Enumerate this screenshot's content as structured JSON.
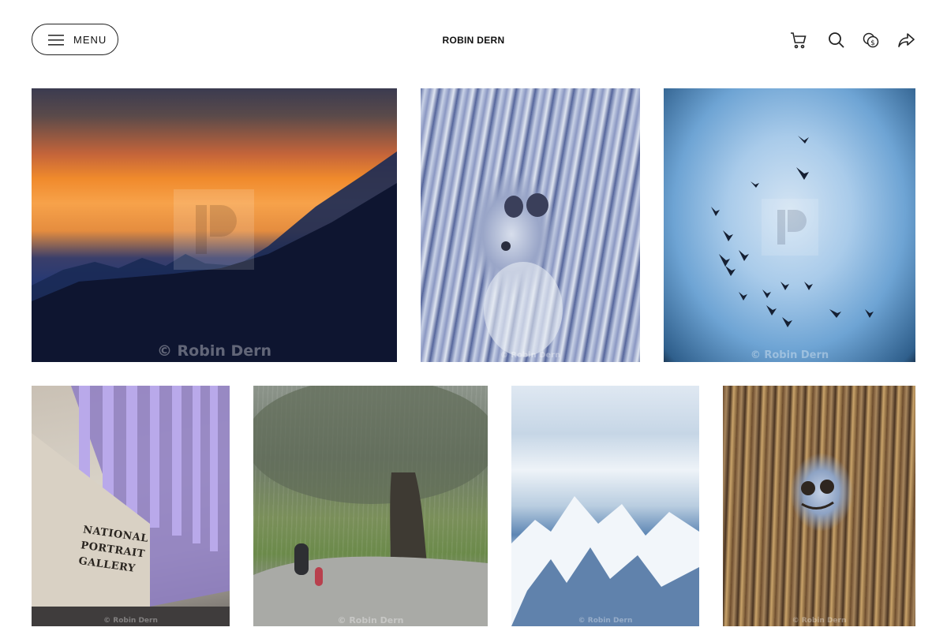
{
  "header": {
    "menu_label": "MENU",
    "site_title": "ROBIN DERN",
    "icons": [
      "cart-icon",
      "search-icon",
      "currency-icon",
      "share-icon"
    ]
  },
  "gallery": {
    "watermark_brand": "PICFAIR",
    "photos": [
      {
        "alt": "Sunset over mountains",
        "credit": "© Robin Dern"
      },
      {
        "alt": "Face in blue tree bark",
        "credit": "© Robin Dern"
      },
      {
        "alt": "Birds flying in blue sky",
        "credit": "© Robin Dern"
      },
      {
        "alt": "National Portrait Gallery",
        "credit": "© Robin Dern",
        "sign_text": "NATIONAL PORTRAIT GALLERY"
      },
      {
        "alt": "Walking in the rain under a tree",
        "credit": "© Robin Dern"
      },
      {
        "alt": "Snowy mountains from above",
        "credit": "© Robin Dern"
      },
      {
        "alt": "Face in rusty tree bark",
        "credit": "© Robin Dern"
      }
    ]
  },
  "colors": {
    "text": "#111111",
    "background": "#ffffff"
  }
}
